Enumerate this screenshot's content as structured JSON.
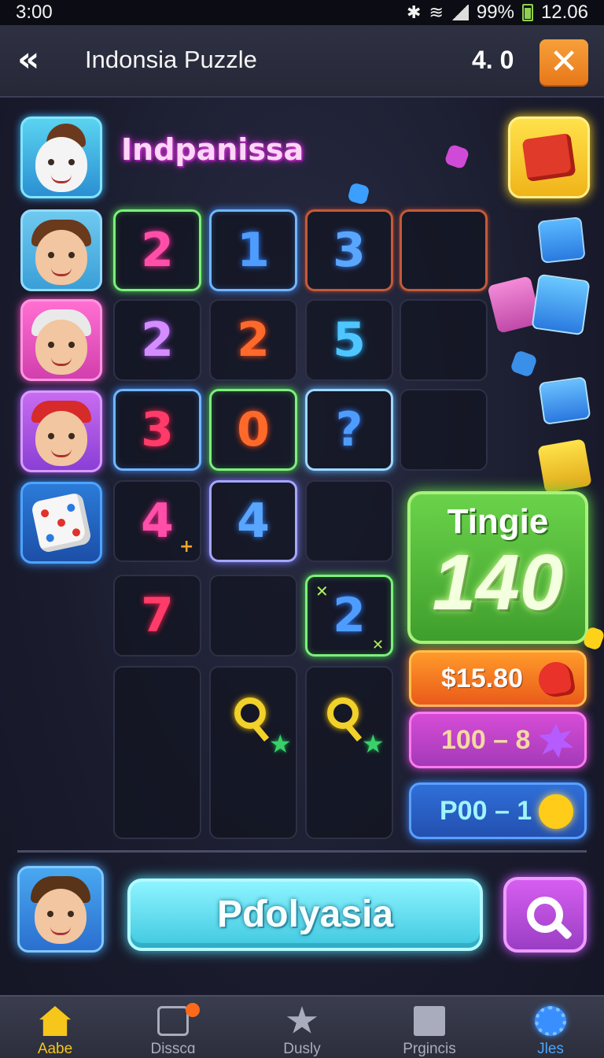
{
  "status_bar": {
    "time": "3:00",
    "battery": "99%",
    "clock_right": "12.06"
  },
  "header": {
    "back_icon": "double-chevron-left-icon",
    "title": "Indonsia Puzzle",
    "score": "4. 0",
    "close_icon": "close-x-icon"
  },
  "player": {
    "name": "Indpanissa"
  },
  "grid": {
    "rows": [
      [
        {
          "v": "2"
        },
        {
          "v": "1"
        },
        {
          "v": "3"
        },
        {
          "v": ""
        }
      ],
      [
        {
          "v": "2"
        },
        {
          "v": "2"
        },
        {
          "v": "5"
        },
        {
          "v": ""
        }
      ],
      [
        {
          "v": "3"
        },
        {
          "v": "0"
        },
        {
          "v": "?"
        },
        {
          "v": ""
        }
      ],
      [
        {
          "v": "4"
        },
        {
          "v": "4"
        },
        {
          "v": ""
        }
      ],
      [
        {
          "v": "7"
        },
        {
          "v": ""
        },
        {
          "v": "2"
        }
      ],
      [
        {
          "v": ""
        },
        {
          "v": ""
        },
        {
          "v": ""
        }
      ]
    ]
  },
  "score_panel": {
    "label": "Tingie",
    "value": "140"
  },
  "stats": [
    {
      "label": "$15.80",
      "icon": "heart-icon",
      "color": "#ea5a1a"
    },
    {
      "label": "100 – 8",
      "icon": "splat-icon",
      "color": "#a43ab8"
    },
    {
      "label": "P00 – 1",
      "icon": "sun-icon",
      "color": "#2350b0"
    }
  ],
  "play_button": {
    "label": "Pɗolyasia"
  },
  "search_button": {
    "icon": "search-icon"
  },
  "nav": [
    {
      "label": "Aabe",
      "icon": "home-icon",
      "active": true
    },
    {
      "label": "Disscɑ",
      "icon": "discover-icon"
    },
    {
      "label": "Dusly",
      "icon": "star-icon"
    },
    {
      "label": "Prgincis",
      "icon": "book-icon"
    },
    {
      "label": "Jles",
      "icon": "gear-icon"
    }
  ]
}
